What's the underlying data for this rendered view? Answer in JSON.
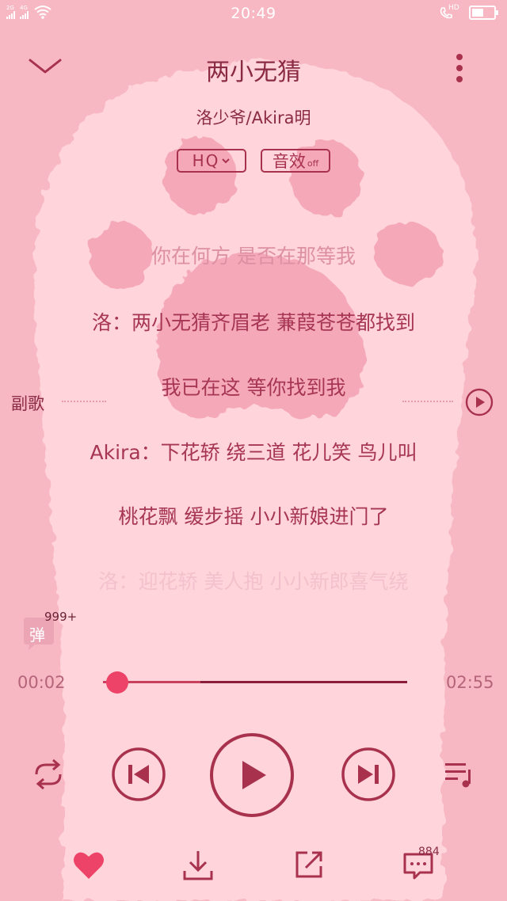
{
  "status_bar": {
    "network_1": "2G",
    "network_2": "4G",
    "time": "20:49",
    "hd_label": "HD"
  },
  "header": {
    "title": "两小无猜",
    "artist": "洛少爷/Akira明",
    "quality_label": "HQ",
    "effect_label": "音效",
    "effect_state": "off"
  },
  "lyrics": {
    "lines": [
      "你在何方 是否在那等我",
      "洛：两小无猜齐眉老 蒹葭苍苍都找到",
      "我已在这 等你找到我",
      "Akira：下花轿 绕三道 花儿笑 鸟儿叫",
      "桃花飘 缓步摇 小小新娘进门了",
      "洛：迎花轿 美人抱 小小新郎喜气绕"
    ],
    "section_label": "副歌"
  },
  "danmu": {
    "label": "弹",
    "count": "999+"
  },
  "player": {
    "current_time": "00:02",
    "total_time": "02:55",
    "progress_fraction": 0.011,
    "buffered_fraction": 0.32
  },
  "bottom": {
    "comment_count": "884"
  },
  "colors": {
    "accent": "#a8324e",
    "heart": "#ee4368",
    "background": "#f7b8c3"
  }
}
